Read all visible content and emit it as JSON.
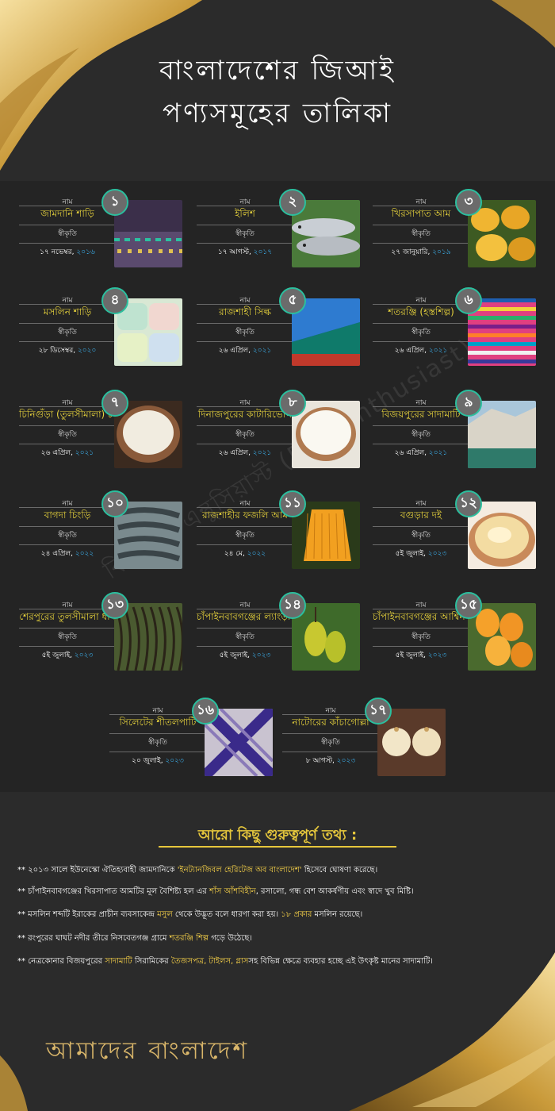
{
  "title_line1": "বাংলাদেশের জিআই",
  "title_line2": "পণ্যসমূহের তালিকা",
  "watermark": "বিসিএস এন্থুসিয়াস্ট (BCS Enthusiast)",
  "label_name": "নাম",
  "label_recognition": "স্বীকৃতি",
  "colors": {
    "background": "#2b2b2b",
    "panel": "#242424",
    "name": "#e6d23c",
    "year": "#3aa7e0",
    "badge_ring": "#2bbf9e",
    "gold": "#c99a3a"
  },
  "items": [
    {
      "num": "১",
      "name": "জামদানি শাড়ি",
      "date": "১৭ নভেম্বর, ",
      "year": "২০১৬",
      "icon": "jamdani-saree-photo"
    },
    {
      "num": "২",
      "name": "ইলিশ",
      "date": "১৭ আগস্ট, ",
      "year": "২০১৭",
      "icon": "hilsa-fish-photo"
    },
    {
      "num": "৩",
      "name": "খিরসাপাত আম",
      "date": "২৭ জানুয়ারি, ",
      "year": "২০১৯",
      "icon": "khirsapat-mango-photo"
    },
    {
      "num": "৪",
      "name": "মসলিন শাড়ি",
      "date": "২৮ ডিসেম্বর, ",
      "year": "২০২০",
      "icon": "muslin-saree-photo"
    },
    {
      "num": "৫",
      "name": "রাজশাহী সিল্ক",
      "date": "২৬ এপ্রিল, ",
      "year": "২০২১",
      "icon": "rajshahi-silk-photo"
    },
    {
      "num": "৬",
      "name": "শতরঞ্জি (হস্তশিল্প)",
      "date": "২৬ এপ্রিল, ",
      "year": "২০২১",
      "icon": "shataranji-photo"
    },
    {
      "num": "৭",
      "name": "চিনিগুঁড়া (তুলসীমালা) চাল",
      "date": "২৬ এপ্রিল, ",
      "year": "২০২১",
      "icon": "chinigura-rice-photo"
    },
    {
      "num": "৮",
      "name": "দিনাজপুরের কাটারিভোগ",
      "date": "২৬ এপ্রিল, ",
      "year": "২০২১",
      "icon": "kataribhog-rice-photo"
    },
    {
      "num": "৯",
      "name": "বিজয়পুরের সাদামাটি",
      "date": "২৬ এপ্রিল, ",
      "year": "২০২১",
      "icon": "white-clay-hill-photo"
    },
    {
      "num": "১০",
      "name": "বাগদা চিংড়ি",
      "date": "২৪ এপ্রিল, ",
      "year": "২০২২",
      "icon": "bagda-shrimp-photo"
    },
    {
      "num": "১১",
      "name": "রাজশাহীর ফজলি আম",
      "date": "২৪ মে, ",
      "year": "২০২২",
      "icon": "fazli-mango-photo"
    },
    {
      "num": "১২",
      "name": "বগুড়ার দই",
      "date": "৫ই জুলাই, ",
      "year": "২০২৩",
      "icon": "bogura-doi-photo"
    },
    {
      "num": "১৩",
      "name": "শেরপুরের তুলসীমালা ধান",
      "date": "৫ই জুলাই, ",
      "year": "২০২৩",
      "icon": "paddy-photo"
    },
    {
      "num": "১৪",
      "name": "চাঁপাইনবাবগঞ্জের ল্যাংড়া আম",
      "date": "৫ই জুলাই, ",
      "year": "২০২৩",
      "icon": "langra-mango-photo"
    },
    {
      "num": "১৫",
      "name": "চাঁপাইনবাবগঞ্জের আশ্বিন আম",
      "date": "৫ই জুলাই, ",
      "year": "২০২৩",
      "icon": "ashwina-mango-photo"
    },
    {
      "num": "১৬",
      "name": "সিলেটের শীতলপাটি",
      "date": "২০ জুলাই, ",
      "year": "২০২৩",
      "icon": "shital-pati-photo"
    },
    {
      "num": "১৭",
      "name": "নাটোরের কাঁচাগোল্লা",
      "date": "৮ আগস্ট, ",
      "year": "২০২৩",
      "icon": "kachagolla-sweet-photo"
    }
  ],
  "facts_title": "আরো কিছু গুরুত্বপূর্ণ তথ্য :",
  "facts": [
    [
      "** ২০১৩ সালে ইউনেস্কো ঐতিহ্যবাহী জামদানিকে ",
      "'ইনট্যানজিবল হেরিটেজ অব বাংলাদেশ'",
      " হিসেবে ঘোষণা করেছে।"
    ],
    [
      "** চাঁপাইনবাবগঞ্জের খিরসাপাত আমটির মূল বৈশিষ্ট্য হল এর ",
      "শাঁস আঁশবিহীন",
      ", রসালো, গন্ধ বেশ আকর্ষণীয় এবং স্বাদে খুব মিষ্টি।"
    ],
    [
      "** মসলিন শব্দটি ইরাকের প্রাচীন ব্যবসাকেন্দ্র ",
      "মসুল",
      " থেকে উদ্ভূত বলে ধারণা করা হয়। ",
      "১৮ প্রকার",
      " মসলিন রয়েছে।"
    ],
    [
      "** রংপুরের ঘাঘট নদীর তীরে নিসবেতগঞ্জ গ্রামে ",
      "শতরঞ্জি শিল্প",
      " গড়ে উঠেছে।"
    ],
    [
      "** নেত্রকোনার বিজয়পুরের ",
      "সাদামাটি",
      " সিরামিকের ",
      "তৈজসপত্র, টাইলস, গ্লাস",
      "সহ বিভিন্ন ক্ষেত্রে ব্যবহার হচ্ছে এই উৎকৃষ্ট মানের সাদামাটি।"
    ]
  ],
  "footer": "আমাদের বাংলাদেশ"
}
